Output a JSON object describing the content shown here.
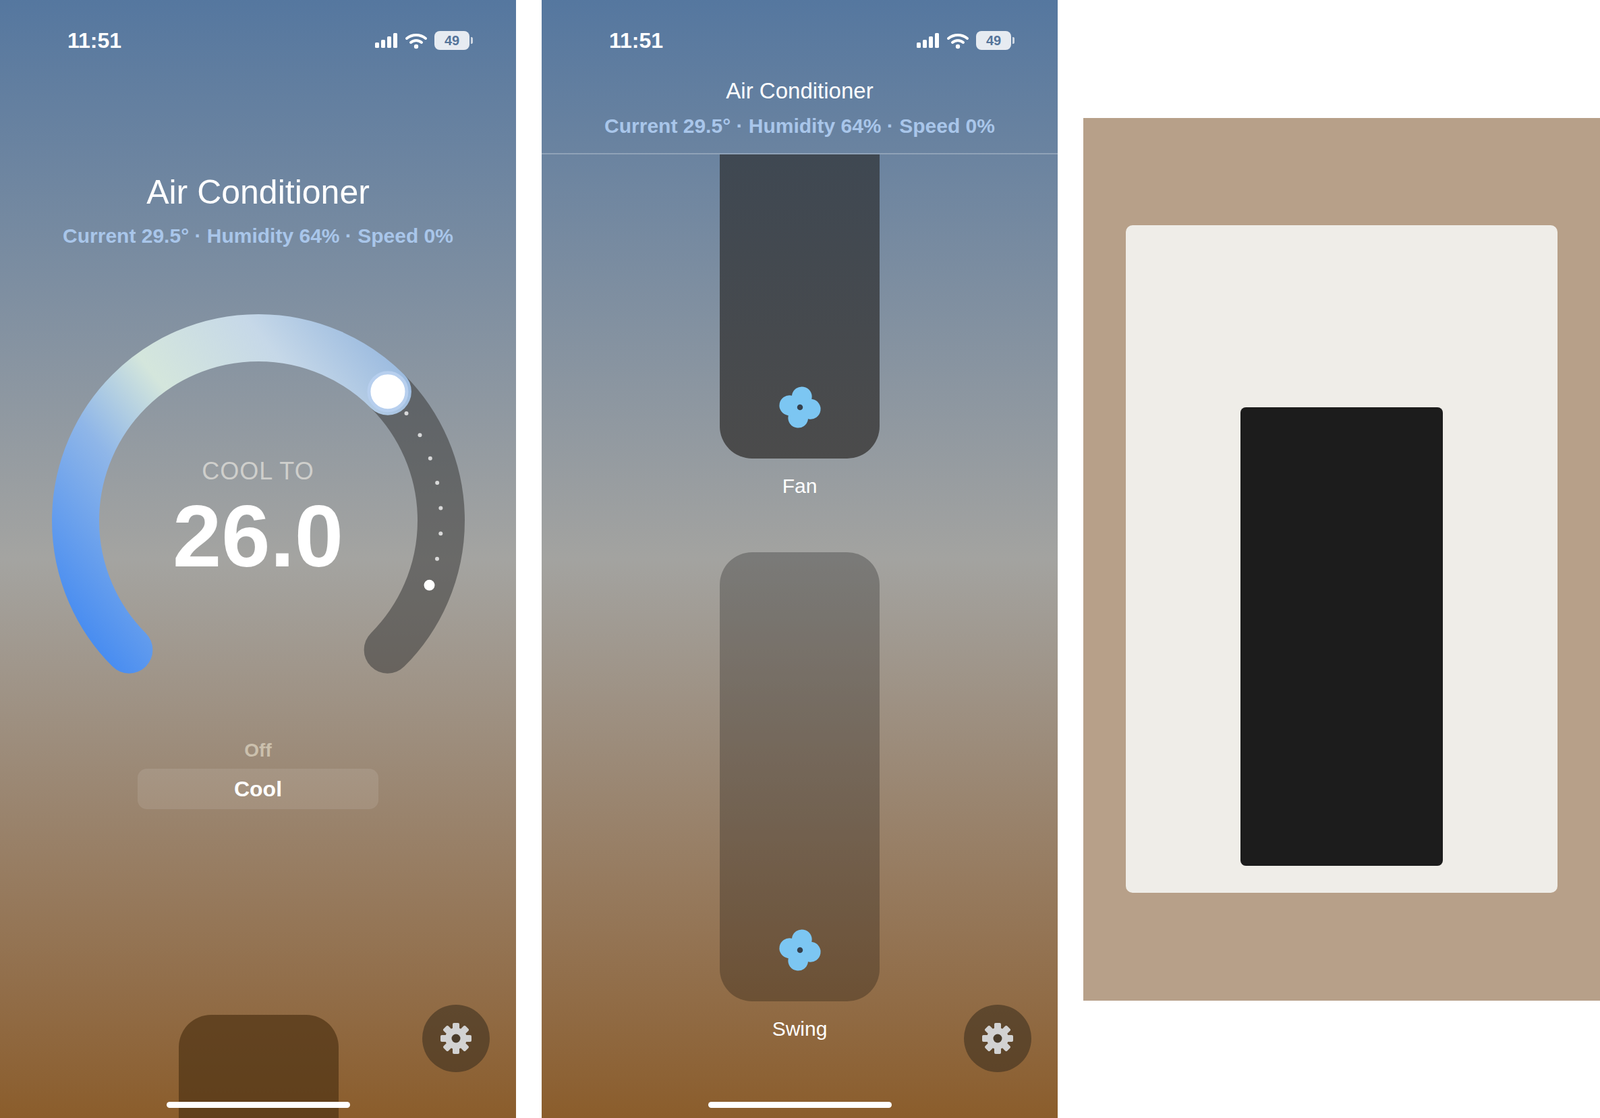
{
  "thermostat": {
    "status": {
      "time": "11:51",
      "battery": "49"
    },
    "title": "Air Conditioner",
    "subtitle": "Current 29.5° · Humidity 64% · Speed 0%",
    "dial": {
      "label": "COOL TO",
      "value": "26.0",
      "level": 0.667,
      "current_level": 0.91
    },
    "modes": [
      {
        "label": "Off",
        "selected": false
      },
      {
        "label": "Cool",
        "selected": true
      }
    ]
  },
  "fan_screen": {
    "status": {
      "time": "11:51",
      "battery": "49"
    },
    "title": "Air Conditioner",
    "subtitle": "Current 29.5° · Humidity 64% · Speed 0%",
    "tiles": [
      {
        "label": "Fan",
        "kind": "top"
      },
      {
        "label": "Swing",
        "kind": "full"
      }
    ]
  }
}
